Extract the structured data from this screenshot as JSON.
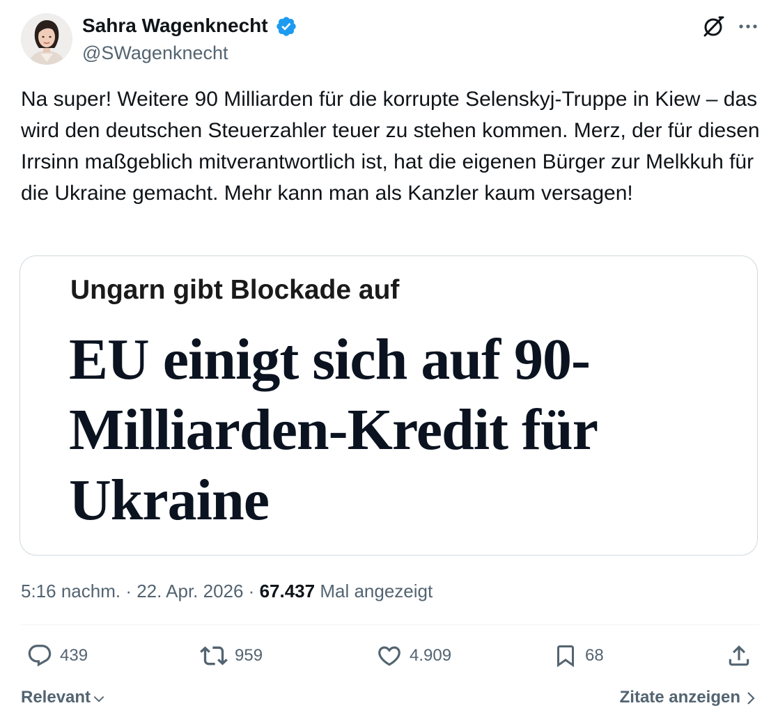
{
  "author": {
    "display_name": "Sahra Wagenknecht",
    "handle": "@SWagenknecht",
    "verified": true
  },
  "tweet": {
    "text": "Na super! Weitere 90 Milliarden für die korrupte Selenskyj-Truppe in Kiew – das wird den deutschen Steuerzahler teuer zu stehen kommen. Merz, der für diesen Irrsinn maßgeblich mitverantwortlich ist, hat die eigenen Bürger zur Melkkuh für die Ukraine gemacht. Mehr kann man als Kanzler kaum versagen!"
  },
  "media": {
    "kicker": "Ungarn gibt Blockade auf",
    "headline": "EU einigt sich auf 90-Milliarden-Kredit für Ukraine"
  },
  "meta": {
    "time": "5:16 nachm.",
    "separator": " · ",
    "date": "22. Apr. 2026",
    "views_count": "67.437",
    "views_label": "Mal angezeigt"
  },
  "actions": {
    "replies": "439",
    "reposts": "959",
    "likes": "4.909",
    "bookmarks": "68"
  },
  "footer": {
    "sort_label": "Relevant",
    "quotes_label": "Zitate anzeigen"
  },
  "colors": {
    "verified_blue": "#1d9bf0",
    "text_primary": "#0f1419",
    "text_secondary": "#536471",
    "border": "#cfd9de"
  },
  "icons": [
    "verified-badge-icon",
    "grok-icon",
    "more-icon",
    "reply-icon",
    "repost-icon",
    "like-icon",
    "bookmark-icon",
    "share-icon",
    "chevron-down-icon",
    "chevron-right-icon"
  ]
}
